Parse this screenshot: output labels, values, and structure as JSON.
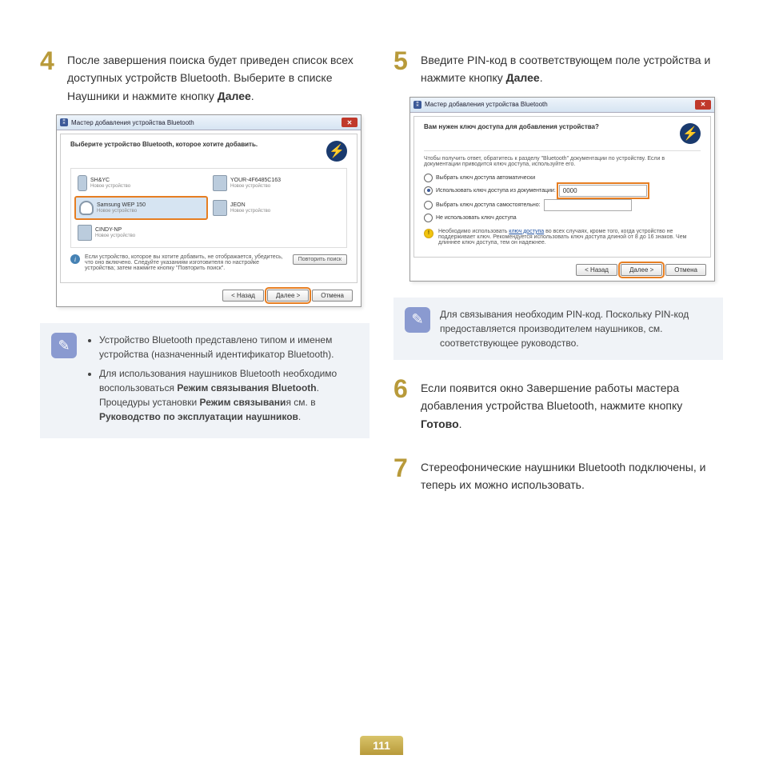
{
  "page_number": "111",
  "step4": {
    "num": "4",
    "text_a": "После завершения поиска будет приведен список всех доступных устройств Bluetooth. Выберите в списке Наушники и нажмите кнопку ",
    "text_b": "Далее",
    "text_c": "."
  },
  "step5": {
    "num": "5",
    "text_a": "Введите PIN-код в соответствующем поле устройства и нажмите кнопку ",
    "text_b": "Далее",
    "text_c": "."
  },
  "step6": {
    "num": "6",
    "text_a": "Если появится окно Завершение работы мастера добавления устройства Bluetooth, нажмите кнопку ",
    "text_b": "Готово",
    "text_c": "."
  },
  "step7": {
    "num": "7",
    "text": "Стереофонические наушники Bluetooth подключены, и теперь их можно использовать."
  },
  "dialog1": {
    "title": "Мастер добавления устройства Bluetooth",
    "heading": "Выберите устройство Bluetooth, которое хотите добавить.",
    "devices": [
      {
        "name": "SH&YC",
        "sub": "Новое устройство"
      },
      {
        "name": "YOUR-4F6485C163",
        "sub": "Новое устройство"
      },
      {
        "name": "Samsung WEP 150",
        "sub": "Новое устройство"
      },
      {
        "name": "JEON",
        "sub": "Новое устройство"
      },
      {
        "name": "CINDY-NP",
        "sub": "Новое устройство"
      }
    ],
    "info": "Если устройство, которое вы хотите добавить, не отображается, убедитесь, что оно включено. Следуйте указаниям изготовителя по настройке устройства; затем нажмите кнопку \"Повторить поиск\".",
    "retry": "Повторить поиск",
    "back": "< Назад",
    "next": "Далее >",
    "cancel": "Отмена"
  },
  "dialog2": {
    "title": "Мастер добавления устройства Bluetooth",
    "heading": "Вам нужен ключ доступа для добавления устройства?",
    "sub": "Чтобы получить ответ, обратитесь к разделу \"Bluetooth\" документации по устройству. Если в документации приводится ключ доступа, используйте его.",
    "opt1": "Выбрать ключ доступа автоматически",
    "opt2": "Использовать ключ доступа из документации:",
    "pin": "0000",
    "opt3": "Выбрать ключ доступа самостоятельно:",
    "opt4": "Не использовать ключ доступа",
    "warn_a": "Необходимо использовать ",
    "warn_link": "ключ доступа",
    "warn_b": " во всех случаях, кроме того, когда устройство не поддерживает ключ. Рекомендуется использовать ключ доступа длиной от 8 до 16 знаков. Чем длиннее ключ доступа, тем он надежнее.",
    "back": "< Назад",
    "next": "Далее >",
    "cancel": "Отмена"
  },
  "note1": {
    "item1": "Устройство Bluetooth представлено типом и именем устройства (назначенный идентификатор Bluetooth).",
    "item2_a": "Для использования наушников Bluetooth необходимо воспользоваться ",
    "item2_b": "Режим связывания Bluetooth",
    "item2_c": ".",
    "item2_d": "Процедуры установки ",
    "item2_e": "Режим связывани",
    "item2_f": "я см. в ",
    "item2_g": "Руководство по эксплуатации наушников",
    "item2_h": "."
  },
  "note2": {
    "text": "Для связывания необходим PIN-код. Поскольку PIN-код предоставляется производителем наушников, см. соответствующее руководство."
  }
}
